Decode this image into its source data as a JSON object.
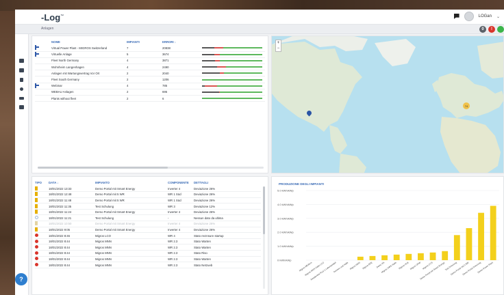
{
  "app": {
    "logo": "-Log",
    "logo_tm": "™",
    "breadcrumb": "Anlagen"
  },
  "user": {
    "name": "LOGan",
    "chevron": "⌄"
  },
  "status": [
    {
      "label": "0",
      "color": "#5b6168"
    },
    {
      "label": "!",
      "color": "#d9342b"
    },
    {
      "label": "",
      "color": "#3bb54a"
    }
  ],
  "help_label": "?",
  "plants": {
    "headers": {
      "name": "NOME",
      "plants": "IMPIANTI",
      "errors": "ERRORI ↓"
    },
    "rows": [
      {
        "fleet": true,
        "name": "Virtual Power Plant - MIGROS Switzerland",
        "plants": "7",
        "errors": "20838",
        "gray": 0.2,
        "red": [
          0.2,
          0.35
        ]
      },
      {
        "fleet": true,
        "name": "Virtuelle Anlage",
        "plants": "5",
        "errors": "3674",
        "gray": 0.2,
        "red": [
          0.2,
          0.3
        ]
      },
      {
        "fleet": false,
        "name": "Fleet North Germany",
        "plants": "4",
        "errors": "3871",
        "gray": 0.22,
        "red": [
          0.22,
          0.3
        ]
      },
      {
        "fleet": false,
        "name": "Wohnheim Langenhagen",
        "plants": "4",
        "errors": "2490",
        "gray": 0.25,
        "red": [
          0.25,
          0.4
        ]
      },
      {
        "fleet": false,
        "name": "Anlagen mit Wartungsvertrag Vor Ort",
        "plants": "2",
        "errors": "2040",
        "gray": 0.3,
        "red": [
          0.3,
          0.36
        ]
      },
      {
        "fleet": false,
        "name": "Fleet South Germany",
        "plants": "2",
        "errors": "1206",
        "gray": 0.0,
        "red": [
          0.0,
          0.0
        ]
      },
      {
        "fleet": true,
        "name": "Webinar",
        "plants": "4",
        "errors": "785",
        "gray": 0.05,
        "red": [
          0.05,
          0.25
        ]
      },
      {
        "fleet": false,
        "name": "WEBAU Anlagen",
        "plants": "2",
        "errors": "695",
        "gray": 0.28,
        "red": [
          0.28,
          0.3
        ]
      },
      {
        "fleet": false,
        "name": "Plants without fleet",
        "plants": "2",
        "errors": "6",
        "gray": 0.0,
        "red": [
          0.0,
          0.0
        ]
      }
    ]
  },
  "events": {
    "headers": {
      "type": "TIPO",
      "date": "DATA ↓",
      "plant": "IMPIANTO",
      "component": "COMPONENTE",
      "details": "DETTAGLI"
    },
    "rows": [
      {
        "icon": "warn",
        "date": "18/01/2022 13:33",
        "plant": "Demo Portal mit Smart Energy",
        "component": "Inverter 4",
        "details": "Deviazione 26%"
      },
      {
        "icon": "warn",
        "date": "18/01/2022 12:48",
        "plant": "Demo Portal mit 5 WR",
        "component": "WR 1 Süd",
        "details": "Deviazione 26%"
      },
      {
        "icon": "warn",
        "date": "18/01/2022 11:48",
        "plant": "Demo Portal mit 5 WR",
        "component": "WR 1 Süd",
        "details": "Deviazione 26%"
      },
      {
        "icon": "warn",
        "date": "18/01/2022 11:35",
        "plant": "Test Schulung",
        "component": "WR 3",
        "details": "Deviazione 12%"
      },
      {
        "icon": "warn",
        "date": "18/01/2022 11:24",
        "plant": "Demo Portal mit Smart Energy",
        "component": "Inverter 4",
        "details": "Deviazione 26%"
      },
      {
        "icon": "info",
        "date": "18/01/2022 11:21",
        "plant": "Test Schulung",
        "component": "-",
        "details": "Nessun dato da ultima"
      },
      {
        "icon": "gray",
        "date": "18/01/2022 10:50",
        "plant": "Demo Portal mit Smart Energy",
        "component": "Inverter 4",
        "details": "Deviazione 26%",
        "faded": true
      },
      {
        "icon": "warn",
        "date": "18/01/2022 9:05",
        "plant": "Demo Portal mit Smart Energy",
        "component": "Inverter 4",
        "details": "Deviazione 26%"
      },
      {
        "icon": "err",
        "date": "18/01/2022 8:46",
        "plant": "Migros LCO",
        "component": "WR 4",
        "details": "Stato recInsure startup"
      },
      {
        "icon": "err",
        "date": "18/01/2022 8:44",
        "plant": "Migros MNN",
        "component": "WR 2.3",
        "details": "Stato Warten"
      },
      {
        "icon": "err",
        "date": "18/01/2022 8:44",
        "plant": "Migros MNN",
        "component": "WR 2.3",
        "details": "Stato Warten"
      },
      {
        "icon": "err",
        "date": "18/01/2022 8:44",
        "plant": "Migros MNN",
        "component": "WR 2.3",
        "details": "Stato Riso"
      },
      {
        "icon": "err",
        "date": "18/01/2022 8:44",
        "plant": "Migros MNN",
        "component": "WR 2.3",
        "details": "Stato Warten"
      },
      {
        "icon": "err",
        "date": "18/01/2022 8:44",
        "plant": "Migros MNN",
        "component": "WR 2.3",
        "details": "Stato Netzueb"
      }
    ]
  },
  "map": {
    "zoom_in": "+",
    "zoom_out": "−",
    "cluster_label": "74"
  },
  "chart_data": {
    "type": "bar",
    "title": "PRODUZIONE DEGLI IMPIANTI",
    "ylim": [
      0,
      5
    ],
    "yticks": [
      "0 kWh/kWp",
      "1.0 kWh/kWp",
      "2.0 kWh/kWp",
      "3.0 kWh/kWp",
      "4.0 kWh/kWp",
      "5.0 kWh/kWp"
    ],
    "categories": [
      "Migros Affoltern",
      "Migros MNN Halle LCO",
      "Residential Pool 1 Lebensmittel",
      "Sonnen und Halle",
      "Migros MNN",
      "Migros EFE",
      "Demo VA",
      "Migros GWS Halle",
      "Migros HLB",
      "Migros GFW",
      "Migros CCS",
      "Demo Portal mit Smart Energy",
      "Test Schulung",
      "Demo Portal mit 5 WR",
      "Demo Portal Schulung",
      "Demo Power Plant"
    ],
    "values": [
      0,
      0,
      0,
      0,
      0.25,
      0.3,
      0.35,
      0.4,
      0.45,
      0.5,
      0.55,
      0.65,
      1.8,
      2.3,
      3.4,
      3.9
    ],
    "color": "#f3d01c"
  }
}
